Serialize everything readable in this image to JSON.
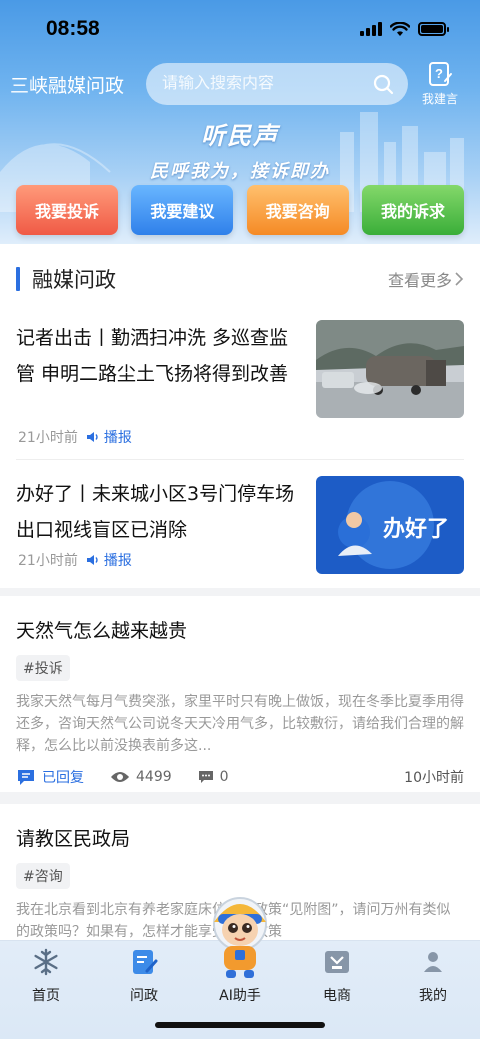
{
  "status_bar": {
    "time": "08:58"
  },
  "header": {
    "app_title": "三峡融媒问政",
    "search_placeholder": "请输入搜索内容",
    "suggest_label": "我建言"
  },
  "banner": {
    "title": "听民声",
    "subtitle": "民呼我为，接诉即办"
  },
  "quick_actions": [
    {
      "label": "我要投诉",
      "color": "#f05a45"
    },
    {
      "label": "我要建议",
      "color": "#2f80ea"
    },
    {
      "label": "我要咨询",
      "color": "#f58a25"
    },
    {
      "label": "我的诉求",
      "color": "#3aae39"
    }
  ],
  "media_section": {
    "title": "融媒问政",
    "more_label": "查看更多",
    "news": [
      {
        "title": "记者出击丨勤洒扫冲洗 多巡查监管 申明二路尘土飞扬将得到改善",
        "time": "21小时前",
        "play_label": "播报"
      },
      {
        "title": "办好了丨未来城小区3号门停车场出口视线盲区已消除",
        "time": "21小时前",
        "play_label": "播报",
        "thumb_text": "办好了"
      }
    ]
  },
  "posts": [
    {
      "title": "天然气怎么越来越贵",
      "tag": "#投诉",
      "body": "我家天然气每月气费突涨，家里平时只有晚上做饭，现在冬季比夏季用得还多，咨询天然气公司说冬天天冷用气多，比较敷衍，请给我们合理的解释，怎么比以前没换表前多这...",
      "reply_label": "已回复",
      "views": "4499",
      "comments": "0",
      "time": "10小时前"
    },
    {
      "title": "请教区民政局",
      "tag": "#咨询",
      "body": "我在北京看到北京有养老家庭床位补助政策“见附图”，请问万州有类似的政策吗？如果有，怎样才能享受这些政策"
    }
  ],
  "tabbar": [
    {
      "label": "首页",
      "icon": "snowflake-icon"
    },
    {
      "label": "问政",
      "icon": "edit-note-icon"
    },
    {
      "label": "AI助手",
      "icon": "robot-avatar-icon"
    },
    {
      "label": "电商",
      "icon": "shop-icon"
    },
    {
      "label": "我的",
      "icon": "user-icon"
    }
  ],
  "colors": {
    "accent": "#2b6fe0",
    "hero_top": "#4a9ae6"
  }
}
